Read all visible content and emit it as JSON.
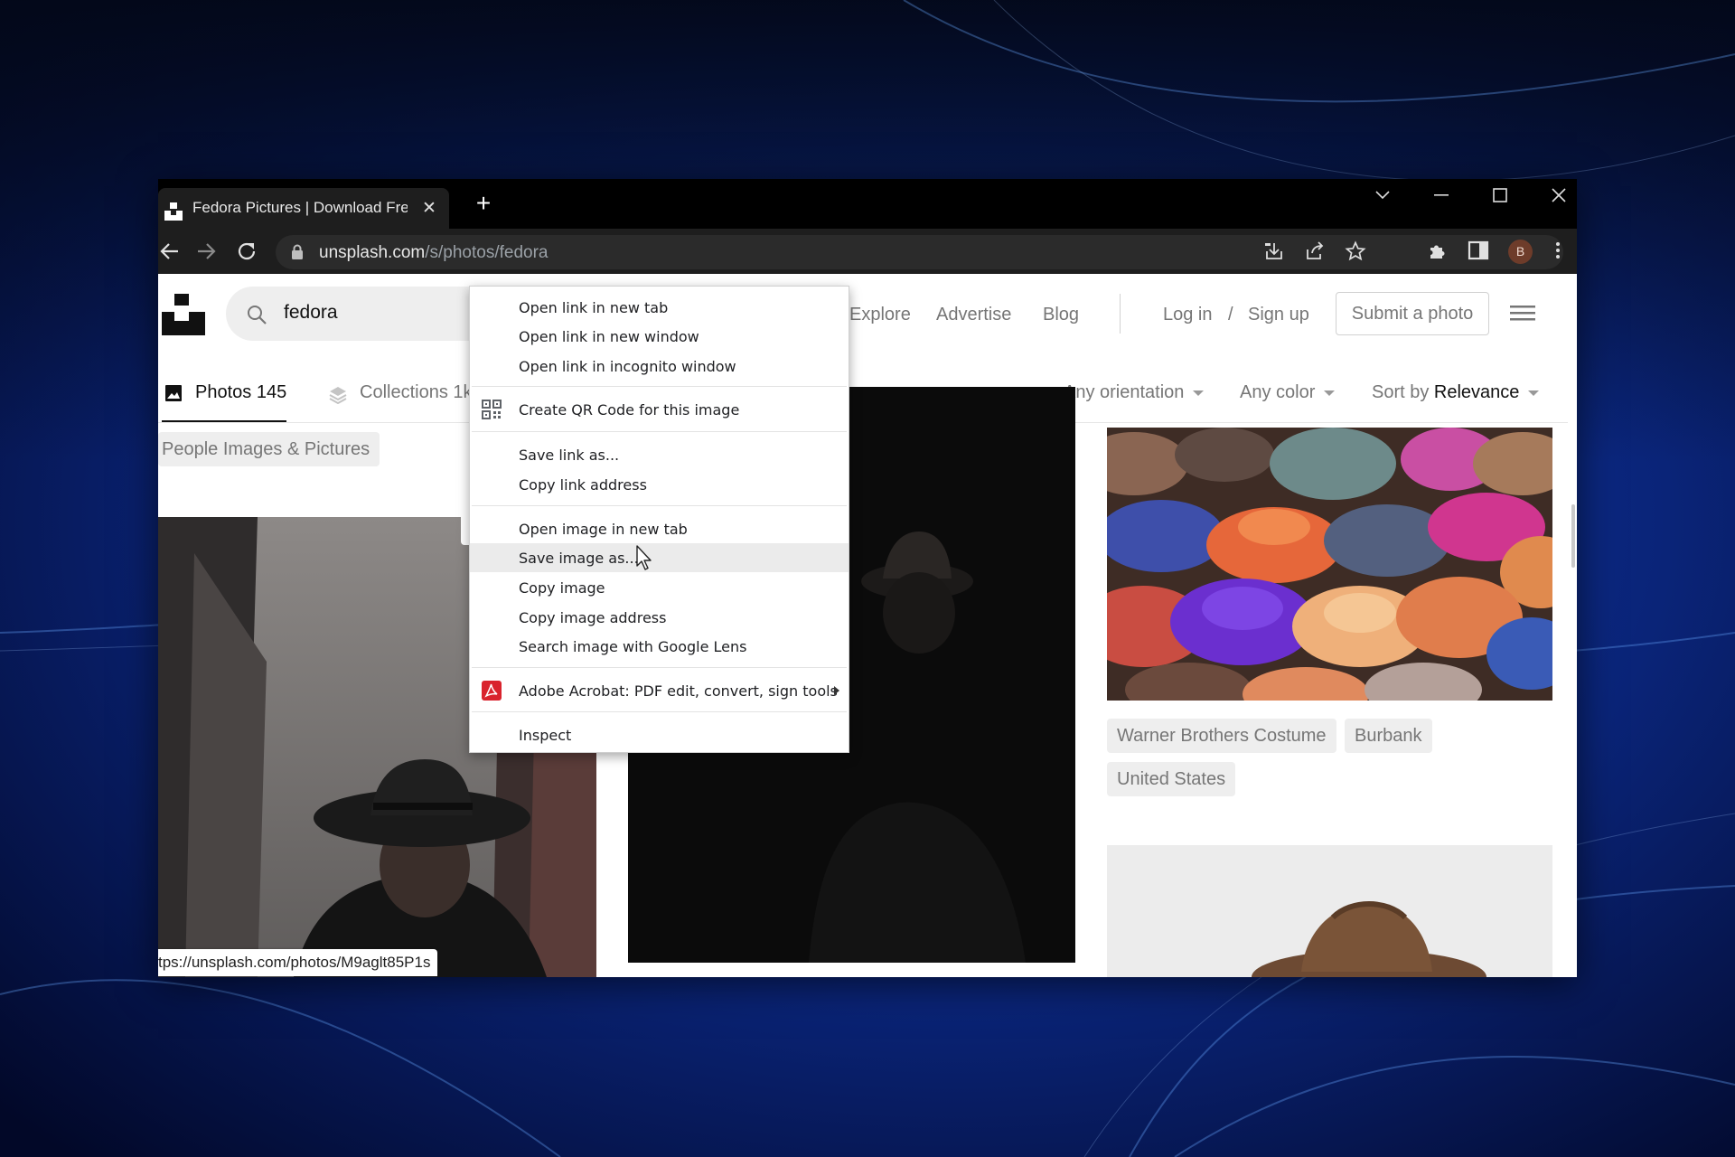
{
  "browser": {
    "tab": {
      "title": "Fedora Pictures | Download Free"
    },
    "address": {
      "host": "unsplash.com",
      "path": "/s/photos/fedora"
    },
    "profile_initial": "B"
  },
  "site": {
    "search_value": "fedora",
    "nav": {
      "explore": "Explore",
      "advertise": "Advertise",
      "blog": "Blog",
      "login": "Log in",
      "separator": "/",
      "signup": "Sign up",
      "submit": "Submit a photo"
    },
    "tabs": {
      "photos": "Photos 145",
      "collections": "Collections 1k"
    },
    "filters": {
      "orientation": "Any orientation",
      "color": "Any color",
      "sort_prefix": "Sort by",
      "sort_value": "Relevance"
    },
    "chips": {
      "people": "People Images & Pictures",
      "warner": "Warner Brothers Costume",
      "burbank": "Burbank",
      "us": "United States"
    },
    "status_url": "tps://unsplash.com/photos/M9aglt85P1s"
  },
  "context_menu": {
    "items": [
      "Open link in new tab",
      "Open link in new window",
      "Open link in incognito window",
      "Create QR Code for this image",
      "Save link as...",
      "Copy link address",
      "Open image in new tab",
      "Save image as...",
      "Copy image",
      "Copy image address",
      "Search image with Google Lens",
      "Adobe Acrobat: PDF edit, convert, sign tools",
      "Inspect"
    ],
    "highlighted": "Save image as..."
  },
  "icons": [
    "unsplash-logo-icon",
    "search-icon",
    "photos-icon",
    "collections-icon",
    "qr-code-icon",
    "adobe-acrobat-icon",
    "lock-icon",
    "back-arrow-icon",
    "forward-arrow-icon",
    "reload-icon",
    "install-icon",
    "share-icon",
    "star-icon",
    "extensions-icon",
    "side-panel-icon",
    "kebab-menu-icon",
    "hamburger-menu-icon"
  ]
}
